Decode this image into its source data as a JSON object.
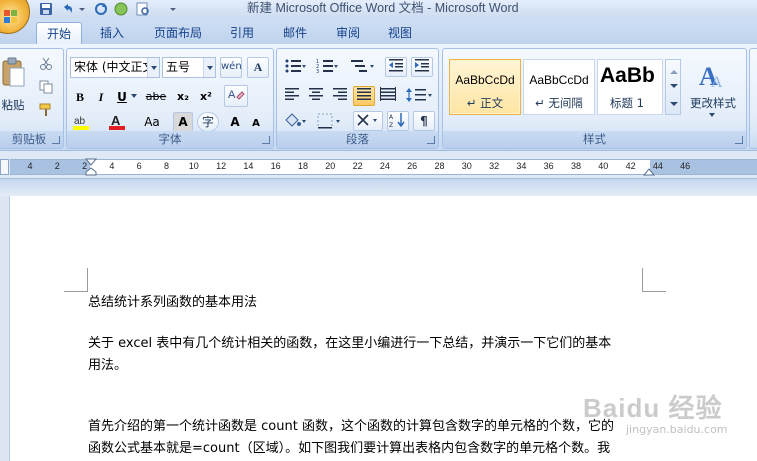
{
  "window": {
    "title": "新建 Microsoft Office Word 文档 - Microsoft Word"
  },
  "tabs": [
    {
      "label": "开始",
      "active": true
    },
    {
      "label": "插入"
    },
    {
      "label": "页面布局"
    },
    {
      "label": "引用"
    },
    {
      "label": "邮件"
    },
    {
      "label": "审阅"
    },
    {
      "label": "视图"
    }
  ],
  "ribbon": {
    "clipboard": {
      "paste_label": "粘贴",
      "group_label": "剪贴板"
    },
    "font": {
      "font_name": "宋体 (中文正文",
      "font_size": "五号",
      "bold": "B",
      "italic": "I",
      "underline": "U",
      "strike": "abe",
      "subscript": "x₂",
      "superscript": "x²",
      "change_case": "Aa",
      "grow": "A",
      "shrink": "A",
      "group_label": "字体"
    },
    "paragraph": {
      "group_label": "段落"
    },
    "styles": {
      "items": [
        {
          "sample": "AaBbCcDd",
          "name": "↵ 正文",
          "selected": true
        },
        {
          "sample": "AaBbCcDd",
          "name": "↵ 无间隔"
        },
        {
          "sample": "AaBb",
          "name": "标题 1"
        }
      ],
      "change_styles_label": "更改样式",
      "group_label": "样式"
    }
  },
  "ruler": {
    "labels": [
      "4",
      "2",
      "2",
      "4",
      "6",
      "8",
      "10",
      "12",
      "14",
      "16",
      "18",
      "20",
      "22",
      "24",
      "26",
      "28",
      "30",
      "32",
      "34",
      "36",
      "38",
      "40",
      "42",
      "44",
      "46"
    ]
  },
  "document": {
    "paragraphs": [
      "总结统计系列函数的基本用法",
      "关于 excel 表中有几个统计相关的函数，在这里小编进行一下总结，并演示一下它们的基本",
      "用法。",
      "首先介绍的第一个统计函数是 count 函数，这个函数的计算包含数字的单元格的个数，它的",
      "函数公式基本就是=count（区域）。如下图我们要计算出表格内包含数字的单元格个数。我"
    ],
    "watermark": "Baidu 经验",
    "watermark_sub": "jingyan.baidu.com"
  },
  "colors": {
    "accent": "#15428b",
    "selected_style": "#ffe5a3",
    "office_orb": "#f2b43c"
  }
}
